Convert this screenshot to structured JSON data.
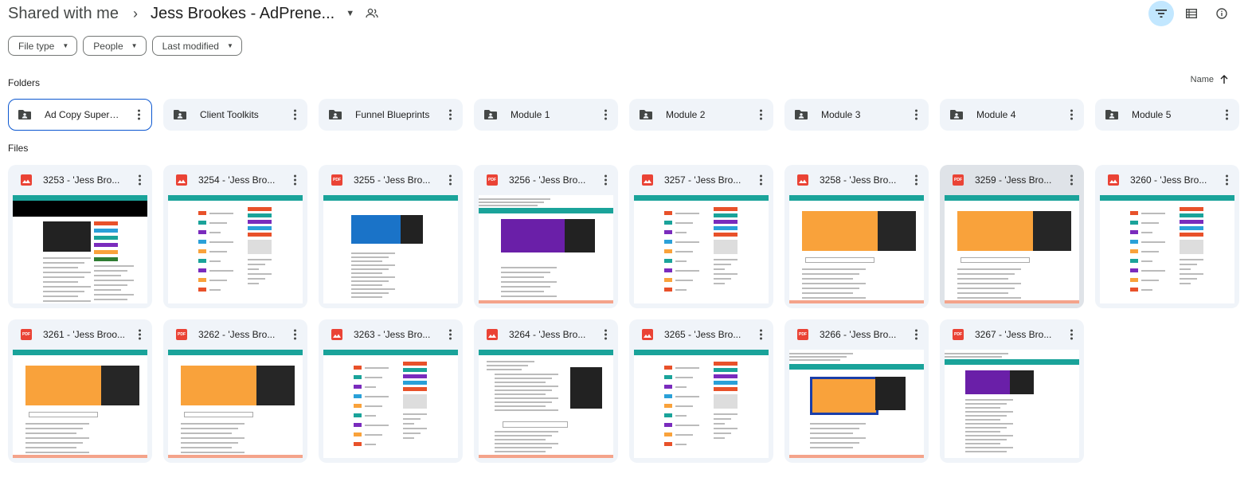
{
  "header": {
    "root": "Shared with me",
    "current": "Jess Brookes - AdPrene..."
  },
  "filters": [
    "File type",
    "People",
    "Last modified"
  ],
  "folders_label": "Folders",
  "files_label": "Files",
  "sort": {
    "label": "Name"
  },
  "folders": [
    {
      "name": "Ad Copy Superst..."
    },
    {
      "name": "Client Toolkits"
    },
    {
      "name": "Funnel Blueprints"
    },
    {
      "name": "Module 1"
    },
    {
      "name": "Module 2"
    },
    {
      "name": "Module 3"
    },
    {
      "name": "Module 4"
    },
    {
      "name": "Module 5"
    }
  ],
  "files": [
    {
      "name": "3253 - 'Jess Bro...",
      "type": "image",
      "thumb": "black"
    },
    {
      "name": "3254 - 'Jess Bro...",
      "type": "image",
      "thumb": "list"
    },
    {
      "name": "3255 - 'Jess Bro...",
      "type": "pdf",
      "thumb": "blue"
    },
    {
      "name": "3256 - 'Jess Bro...",
      "type": "pdf",
      "thumb": "purple"
    },
    {
      "name": "3257 - 'Jess Bro...",
      "type": "image",
      "thumb": "list"
    },
    {
      "name": "3258 - 'Jess Bro...",
      "type": "image",
      "thumb": "orange"
    },
    {
      "name": "3259 - 'Jess Bro...",
      "type": "pdf",
      "thumb": "orange"
    },
    {
      "name": "3260 - 'Jess Bro...",
      "type": "image",
      "thumb": "list"
    },
    {
      "name": "3261 - 'Jess Broo...",
      "type": "pdf",
      "thumb": "orange"
    },
    {
      "name": "3262 - 'Jess Bro...",
      "type": "pdf",
      "thumb": "orange"
    },
    {
      "name": "3263 - 'Jess Bro...",
      "type": "image",
      "thumb": "list"
    },
    {
      "name": "3264 - 'Jess Bro...",
      "type": "image",
      "thumb": "doc"
    },
    {
      "name": "3265 - 'Jess Bro...",
      "type": "image",
      "thumb": "list"
    },
    {
      "name": "3266 - 'Jess Bro...",
      "type": "pdf",
      "thumb": "orangeblue"
    },
    {
      "name": "3267 - 'Jess Bro...",
      "type": "pdf",
      "thumb": "purple2"
    }
  ],
  "colors": {
    "accent": "#0b57d0",
    "teal": "#1aa39a",
    "orange": "#f9a23b",
    "purple": "#6a1fa8",
    "pdf_red": "#ea4335"
  },
  "icons": {
    "pdf_badge": "PDF"
  }
}
